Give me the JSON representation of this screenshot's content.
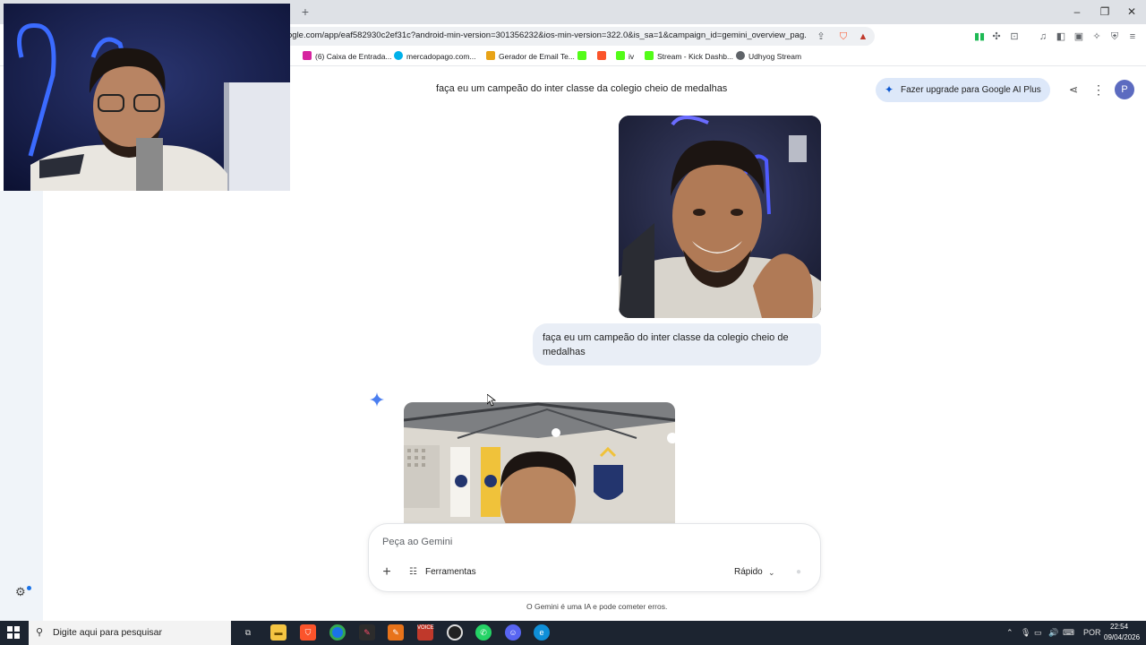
{
  "browser": {
    "url": "ogle.com/app/eaf582930c2ef31c?android-min-version=301356232&ios-min-version=322.0&is_sa=1&campaign_id=gemini_overview_pag...",
    "bookmarks": [
      {
        "label": "(6) Caixa de Entrada...",
        "icon": "instagram-icon",
        "color": "#d6249f"
      },
      {
        "label": "mercadopago.com...",
        "icon": "mercadopago-icon",
        "color": "#00b1ea"
      },
      {
        "label": "Gerador de Email Te...",
        "icon": "pencil-icon",
        "color": "#e8a317"
      },
      {
        "label": "",
        "icon": "kick-icon",
        "color": "#53fc18"
      },
      {
        "label": "",
        "icon": "brave-icon",
        "color": "#fb542b"
      },
      {
        "label": "iv",
        "icon": "kick-icon",
        "color": "#53fc18"
      },
      {
        "label": "Stream - Kick Dashb...",
        "icon": "kick-icon",
        "color": "#53fc18"
      },
      {
        "label": "Udhyog Stream",
        "icon": "globe-icon",
        "color": "#5f6368"
      }
    ],
    "new_tab": "+",
    "window_controls": {
      "minimize": "–",
      "restore": "❐",
      "close": "✕"
    }
  },
  "gemini": {
    "chat_title": "faça eu um campeão do inter classe da colegio cheio de medalhas",
    "upgrade_label": "Fazer upgrade para Google AI Plus",
    "avatar_letter": "P",
    "user_message": "faça eu um campeão do inter classe da colegio cheio de medalhas",
    "prompt_placeholder": "Peça ao Gemini",
    "tools_label": "Ferramentas",
    "mode_label": "Rápido",
    "disclaimer": "O Gemini é uma IA e pode cometer erros.",
    "accent": "#0b57d0"
  },
  "taskbar": {
    "search_placeholder": "Digite aqui para pesquisar",
    "language": "POR",
    "time": "22:54",
    "date": "09/04/2026",
    "apps": [
      "task-view-icon",
      "file-explorer-icon",
      "brave-icon",
      "chrome-icon",
      "app-icon",
      "app-icon",
      "voicemeeter-icon",
      "obs-icon",
      "whatsapp-icon",
      "discord-icon",
      "edge-icon"
    ]
  }
}
